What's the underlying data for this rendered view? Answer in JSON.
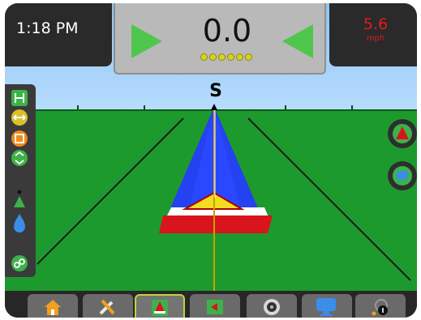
{
  "status": {
    "time": "1:18 PM",
    "speed_value": "5.6",
    "speed_unit": "mph"
  },
  "lightbar": {
    "cross_track": "0.0",
    "led_count": 6,
    "steer_left_arrow_color": "#4fc64c",
    "steer_right_arrow_color": "#4fc64c",
    "led_color": "#d7d31a"
  },
  "guidance": {
    "heading_letter": "S",
    "sky_color": "#a6d2fb",
    "ground_color": "#1d9a2d",
    "swath_color": "#2244ee",
    "implement_color": "#d8141c"
  },
  "left_toolbar": {
    "icons": [
      "guidance-mode-icon",
      "swath-width-icon",
      "section-status-icon",
      "ab-pattern-icon",
      "nudge-icon",
      "application-rate-icon",
      "ab-link-icon"
    ]
  },
  "right_buttons": {
    "icons": [
      "guidance-view-icon",
      "map-view-icon"
    ]
  },
  "bottom_tabs": [
    {
      "name": "home-tab",
      "icon": "home-icon"
    },
    {
      "name": "tools-tab",
      "icon": "tools-icon"
    },
    {
      "name": "guidance-tab",
      "icon": "guidance-icon",
      "active": true
    },
    {
      "name": "field-map-tab",
      "icon": "field-map-icon"
    },
    {
      "name": "tank-tab",
      "icon": "tank-icon"
    },
    {
      "name": "computer-tab",
      "icon": "computer-icon"
    },
    {
      "name": "gnss-tab",
      "icon": "gnss-status-icon"
    }
  ]
}
